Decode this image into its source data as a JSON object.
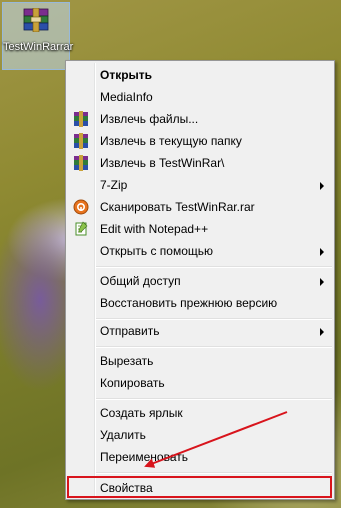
{
  "desktop": {
    "icon_label": "TestWinRarrar"
  },
  "menu": {
    "items": [
      {
        "label": "Открыть"
      },
      {
        "label": "MediaInfo"
      },
      {
        "label": "Извлечь файлы..."
      },
      {
        "label": "Извлечь в текущую папку"
      },
      {
        "label": "Извлечь в TestWinRar\\"
      },
      {
        "label": "7-Zip"
      },
      {
        "label": "Сканировать TestWinRar.rar"
      },
      {
        "label": "Edit with Notepad++"
      },
      {
        "label": "Открыть с помощью"
      },
      {
        "label": "Общий доступ"
      },
      {
        "label": "Восстановить прежнюю версию"
      },
      {
        "label": "Отправить"
      },
      {
        "label": "Вырезать"
      },
      {
        "label": "Копировать"
      },
      {
        "label": "Создать ярлык"
      },
      {
        "label": "Удалить"
      },
      {
        "label": "Переименовать"
      },
      {
        "label": "Свойства"
      }
    ]
  },
  "annotation": {
    "highlight_color": "#d8141c",
    "arrow_color": "#d8141c"
  }
}
